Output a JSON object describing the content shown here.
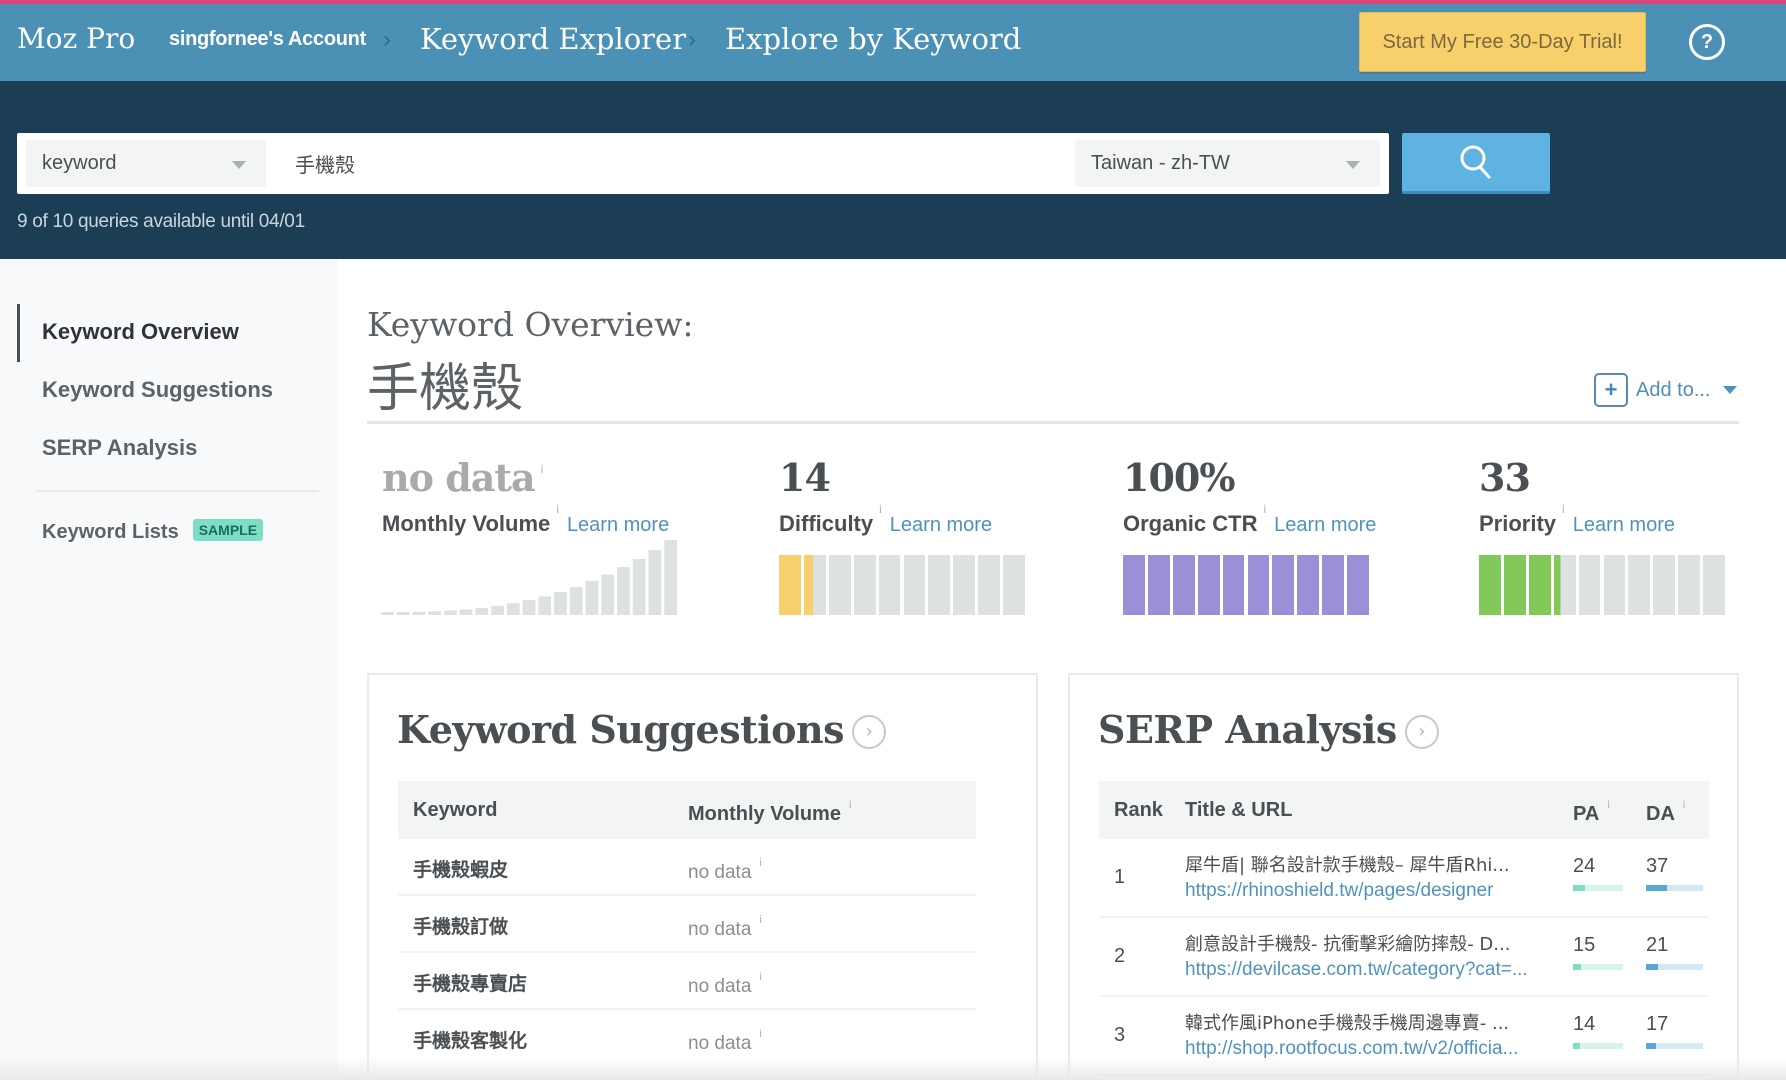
{
  "header": {
    "brand": "Moz Pro",
    "account": "singfornee's Account",
    "breadcrumb": [
      "Keyword Explorer",
      "Explore by Keyword"
    ],
    "separator": "›",
    "trial_button": "Start My Free 30-Day Trial!",
    "help_icon": "?"
  },
  "search": {
    "type_select": "keyword",
    "query": "手機殼",
    "locale_select": "Taiwan - zh-TW",
    "quota_text": "9 of 10 queries available until 04/01"
  },
  "sidebar": {
    "items": [
      {
        "label": "Keyword Overview",
        "active": true
      },
      {
        "label": "Keyword Suggestions",
        "active": false
      },
      {
        "label": "SERP Analysis",
        "active": false
      }
    ],
    "lists_label": "Keyword Lists",
    "sample_badge": "SAMPLE"
  },
  "overview": {
    "title": "Keyword Overview:",
    "keyword": "手機殼",
    "add_to": "Add to...",
    "info_glyph": "i",
    "learn_more": "Learn more",
    "metrics": [
      {
        "id": "volume",
        "value": "no data",
        "label": "Monthly Volume"
      },
      {
        "id": "difficulty",
        "value": "14",
        "label": "Difficulty",
        "score": 14,
        "max": 100,
        "color": "#f7cf6b"
      },
      {
        "id": "ctr",
        "value": "100%",
        "label": "Organic CTR",
        "score": 100,
        "max": 100,
        "color": "#9b8fd8"
      },
      {
        "id": "priority",
        "value": "33",
        "label": "Priority",
        "score": 33,
        "max": 100,
        "color": "#82c95a"
      }
    ],
    "segment_empty_color": "#dde1e2"
  },
  "keyword_suggestions": {
    "title": "Keyword Suggestions",
    "columns": [
      "Keyword",
      "Monthly Volume"
    ],
    "rows": [
      {
        "keyword": "手機殼蝦皮",
        "volume": "no data"
      },
      {
        "keyword": "手機殼訂做",
        "volume": "no data"
      },
      {
        "keyword": "手機殼專賣店",
        "volume": "no data"
      },
      {
        "keyword": "手機殼客製化",
        "volume": "no data"
      }
    ]
  },
  "serp_analysis": {
    "title": "SERP Analysis",
    "columns": [
      "Rank",
      "Title & URL",
      "PA",
      "DA"
    ],
    "rows": [
      {
        "rank": "1",
        "title": "犀牛盾| 聯名設計款手機殼– 犀牛盾Rhi...",
        "url": "https://rhinoshield.tw/pages/designer",
        "pa": 24,
        "da": 37
      },
      {
        "rank": "2",
        "title": "創意設計手機殼- 抗衝擊彩繪防摔殼- D...",
        "url": "https://devilcase.com.tw/category?cat=...",
        "pa": 15,
        "da": 21
      },
      {
        "rank": "3",
        "title": "韓式作風iPhone手機殼手機周邊專賣- ...",
        "url": "http://shop.rootfocus.com.tw/v2/officia...",
        "pa": 14,
        "da": 17
      }
    ],
    "pa_colors": {
      "fill": "#7fdcc5",
      "track": "#d6f3ec"
    },
    "da_colors": {
      "fill": "#5aa6d6",
      "track": "#d3e9f5"
    }
  }
}
